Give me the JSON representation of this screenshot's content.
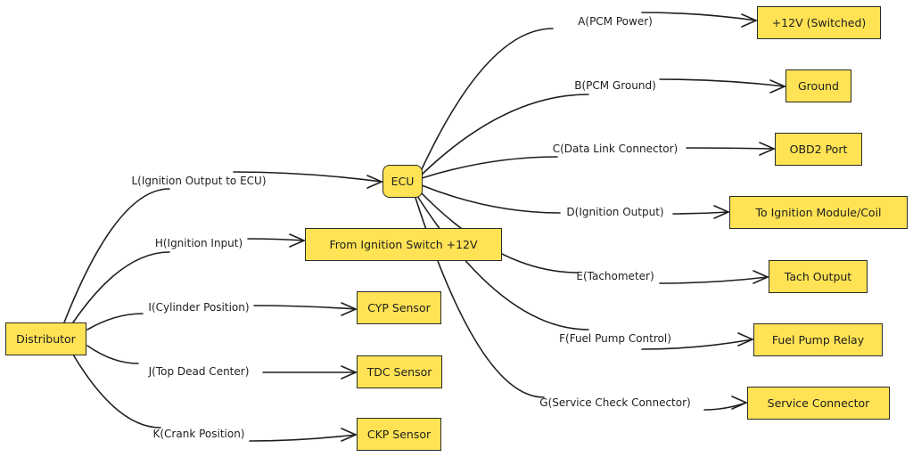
{
  "colors": {
    "node_fill": "#ffe355",
    "stroke": "#1e1e1e",
    "background": "#ffffff"
  },
  "nodes": {
    "distributor": "Distributor",
    "ecu": "ECU",
    "ignition_switch": "From Ignition Switch +12V",
    "cyp": "CYP Sensor",
    "tdc": "TDC Sensor",
    "ckp": "CKP Sensor",
    "v12": "+12V (Switched)",
    "ground": "Ground",
    "obd2": "OBD2 Port",
    "ign_module": "To Ignition Module/Coil",
    "tach": "Tach Output",
    "fuel_relay": "Fuel Pump Relay",
    "service": "Service Connector"
  },
  "edges": {
    "L": "L(Ignition Output to ECU)",
    "H": "H(Ignition Input)",
    "I": "I(Cylinder Position)",
    "J": "J(Top Dead Center)",
    "K": "K(Crank Position)",
    "A": "A(PCM Power)",
    "B": "B(PCM Ground)",
    "C": "C(Data Link Connector)",
    "D": "D(Ignition Output)",
    "E": "E(Tachometer)",
    "F": "F(Fuel Pump Control)",
    "G": "G(Service Check Connector)"
  }
}
